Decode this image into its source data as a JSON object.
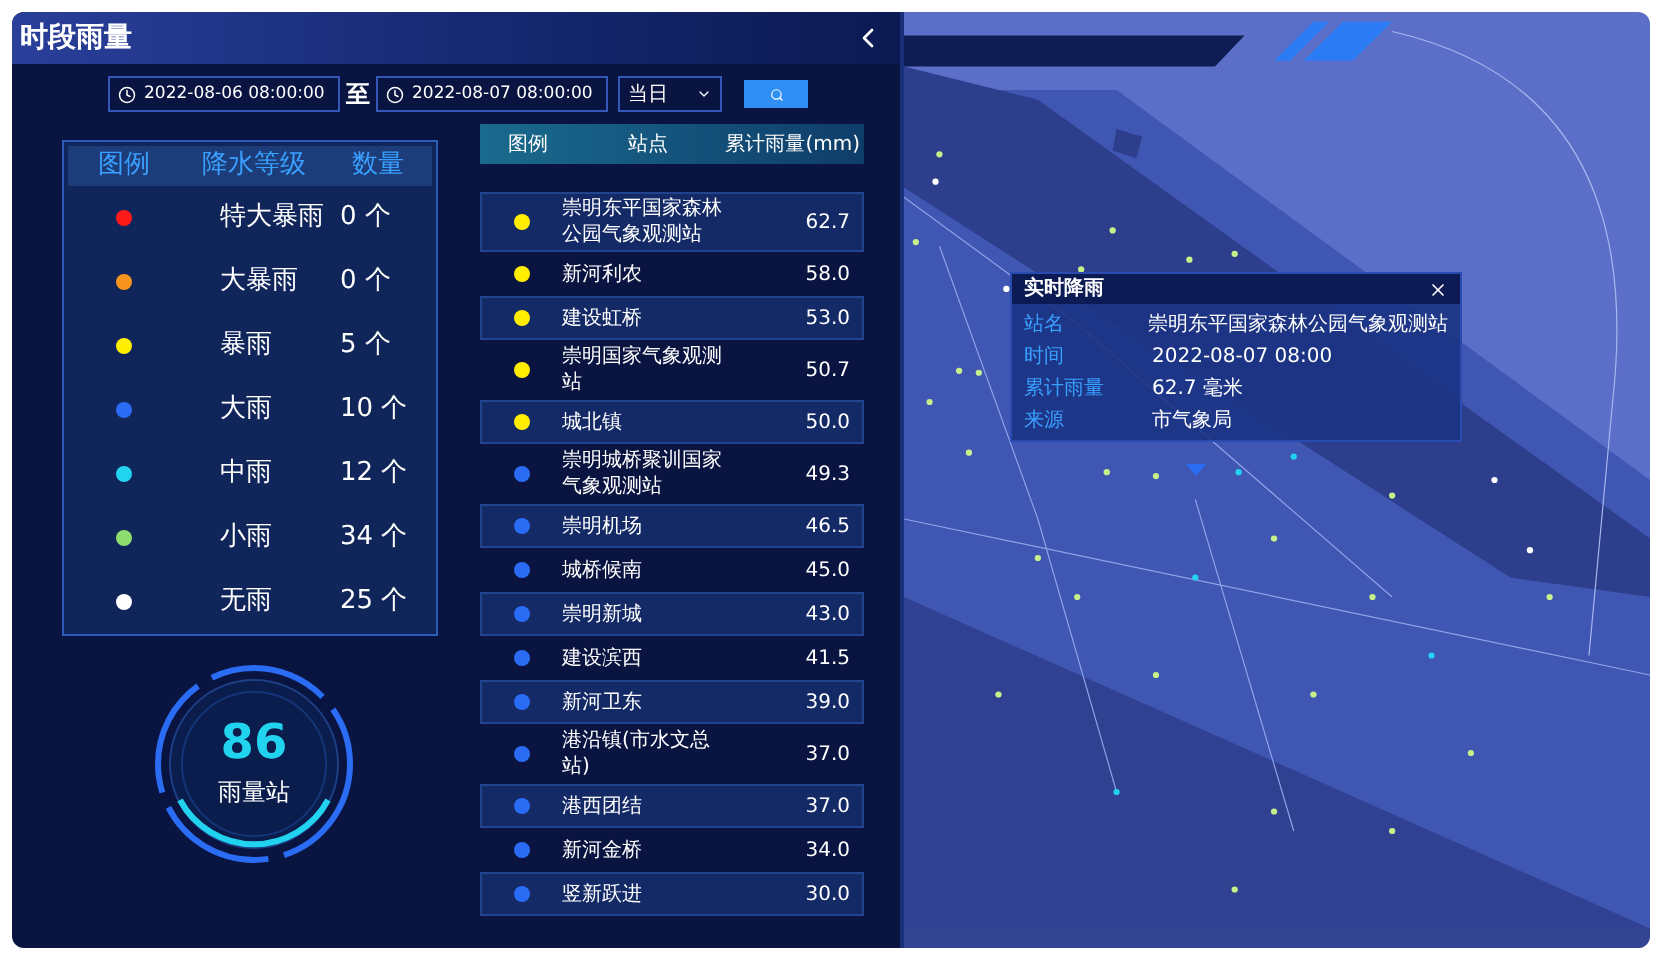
{
  "panel": {
    "title": "时段雨量"
  },
  "filter": {
    "start": "2022-08-06 08:00:00",
    "separator": "至",
    "end": "2022-08-07 08:00:00",
    "period": "当日"
  },
  "legend": {
    "columns": [
      "图例",
      "降水等级",
      "数量"
    ],
    "rows": [
      {
        "color": "#ff1a1a",
        "label": "特大暴雨",
        "count": "0 个"
      },
      {
        "color": "#f7941d",
        "label": "大暴雨",
        "count": "0 个"
      },
      {
        "color": "#ffee00",
        "label": "暴雨",
        "count": "5 个"
      },
      {
        "color": "#2a6df4",
        "label": "大雨",
        "count": "10 个"
      },
      {
        "color": "#22d3f0",
        "label": "中雨",
        "count": "12 个"
      },
      {
        "color": "#8fdc6f",
        "label": "小雨",
        "count": "34 个"
      },
      {
        "color": "#ffffff",
        "label": "无雨",
        "count": "25 个"
      }
    ]
  },
  "gauge": {
    "value": "86",
    "label": "雨量站"
  },
  "table": {
    "columns": [
      "图例",
      "站点",
      "累计雨量(mm)"
    ],
    "rows": [
      {
        "color": "#ffee00",
        "station": "崇明东平国家森林公园气象观测站",
        "rain": "62.7"
      },
      {
        "color": "#ffee00",
        "station": "新河利农",
        "rain": "58.0"
      },
      {
        "color": "#ffee00",
        "station": "建设虹桥",
        "rain": "53.0"
      },
      {
        "color": "#ffee00",
        "station": "崇明国家气象观测站",
        "rain": "50.7"
      },
      {
        "color": "#ffee00",
        "station": "城北镇",
        "rain": "50.0"
      },
      {
        "color": "#2a6df4",
        "station": "崇明城桥聚训国家气象观测站",
        "rain": "49.3"
      },
      {
        "color": "#2a6df4",
        "station": "崇明机场",
        "rain": "46.5"
      },
      {
        "color": "#2a6df4",
        "station": "城桥候南",
        "rain": "45.0"
      },
      {
        "color": "#2a6df4",
        "station": "崇明新城",
        "rain": "43.0"
      },
      {
        "color": "#2a6df4",
        "station": "建设滨西",
        "rain": "41.5"
      },
      {
        "color": "#2a6df4",
        "station": "新河卫东",
        "rain": "39.0"
      },
      {
        "color": "#2a6df4",
        "station": "港沿镇(市水文总站)",
        "rain": "37.0"
      },
      {
        "color": "#2a6df4",
        "station": "港西团结",
        "rain": "37.0"
      },
      {
        "color": "#2a6df4",
        "station": "新河金桥",
        "rain": "34.0"
      },
      {
        "color": "#2a6df4",
        "station": "竖新跃进",
        "rain": "30.0"
      }
    ]
  },
  "popup": {
    "title": "实时降雨",
    "fields": [
      {
        "label": "站名",
        "value": "崇明东平国家森林公园气象观测站"
      },
      {
        "label": "时间",
        "value": "2022-08-07 08:00"
      },
      {
        "label": "累计雨量",
        "value": "62.7 毫米"
      },
      {
        "label": "来源",
        "value": "市气象局"
      }
    ]
  }
}
